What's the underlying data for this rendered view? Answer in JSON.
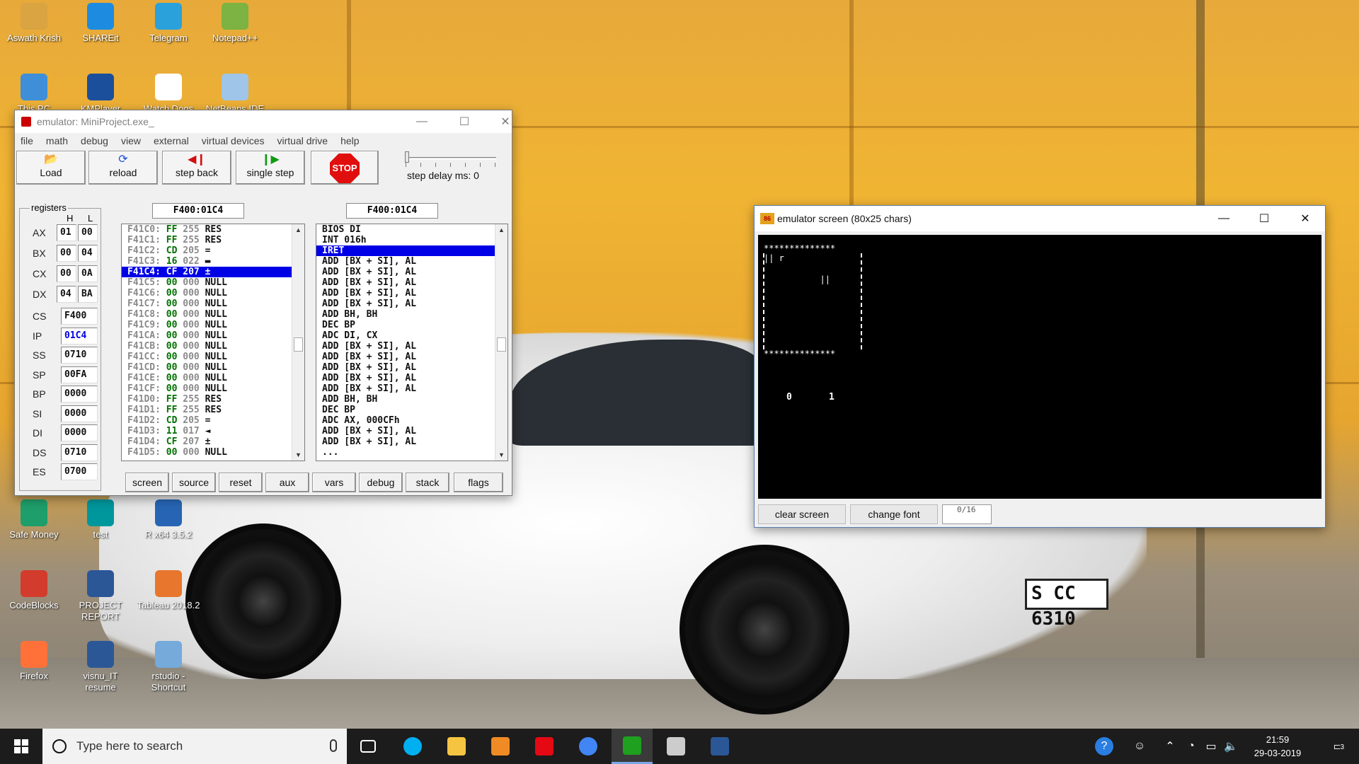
{
  "desktop": {
    "icons": [
      {
        "label": "Aswath Krish",
        "icon": "user-folder-icon",
        "color": "#d9a441"
      },
      {
        "label": "SHAREit",
        "icon": "shareit-icon",
        "color": "#1d8ce0"
      },
      {
        "label": "Telegram",
        "icon": "telegram-icon",
        "color": "#2aa1da"
      },
      {
        "label": "Notepad++",
        "icon": "notepadpp-icon",
        "color": "#7cb342"
      },
      {
        "label": "This PC",
        "icon": "computer-icon",
        "color": "#3f8fd8"
      },
      {
        "label": "KMPlayer",
        "icon": "kmplayer-icon",
        "color": "#1b4f9c"
      },
      {
        "label": "Watch Dogs",
        "icon": "watchdogs-icon",
        "color": "#ffffff"
      },
      {
        "label": "NetBeans IDE",
        "icon": "netbeans-icon",
        "color": "#9fc5e8"
      },
      {
        "label": "Safe Money",
        "icon": "safemoney-icon",
        "color": "#1e9e6a"
      },
      {
        "label": "test",
        "icon": "arduino-file-icon",
        "color": "#00979c"
      },
      {
        "label": "R x64 3.5.2",
        "icon": "r-icon",
        "color": "#2765b4"
      },
      {
        "label": "CodeBlocks",
        "icon": "codeblocks-icon",
        "color": "#d33c2c"
      },
      {
        "label": "PROJECT REPORT",
        "icon": "word-doc-icon",
        "color": "#2b5797"
      },
      {
        "label": "Tableau 2018.2",
        "icon": "tableau-icon",
        "color": "#e8762d"
      },
      {
        "label": "Firefox",
        "icon": "firefox-icon",
        "color": "#ff7139"
      },
      {
        "label": "visnu_IT resume",
        "icon": "word-doc-icon",
        "color": "#2b5797"
      },
      {
        "label": "rstudio - Shortcut",
        "icon": "rstudio-icon",
        "color": "#75aadb"
      }
    ],
    "plate": "S CC 6310"
  },
  "emulator": {
    "title": "emulator: MiniProject.exe_",
    "menu": [
      "file",
      "math",
      "debug",
      "view",
      "external",
      "virtual devices",
      "virtual drive",
      "help"
    ],
    "toolbar": {
      "load": "Load",
      "reload": "reload",
      "step_back": "step back",
      "single_step": "single step",
      "stop": "STOP",
      "step_delay": "step delay ms: 0"
    },
    "registers_title": "registers",
    "hl": {
      "h": "H",
      "l": "L"
    },
    "gp_registers": [
      {
        "name": "AX",
        "h": "01",
        "l": "00"
      },
      {
        "name": "BX",
        "h": "00",
        "l": "04"
      },
      {
        "name": "CX",
        "h": "00",
        "l": "0A"
      },
      {
        "name": "DX",
        "h": "04",
        "l": "BA"
      }
    ],
    "seg_registers": [
      {
        "name": "CS",
        "value": "F400"
      },
      {
        "name": "IP",
        "value": "01C4"
      },
      {
        "name": "SS",
        "value": "0710"
      },
      {
        "name": "SP",
        "value": "00FA"
      },
      {
        "name": "BP",
        "value": "0000"
      },
      {
        "name": "SI",
        "value": "0000"
      },
      {
        "name": "DI",
        "value": "0000"
      },
      {
        "name": "DS",
        "value": "0710"
      },
      {
        "name": "ES",
        "value": "0700"
      }
    ],
    "memory_address": "F400:01C4",
    "disasm_address": "F400:01C4",
    "memory_rows": [
      {
        "addr": "F41C0:",
        "hex": "FF",
        "dec": "255",
        "chr": "RES"
      },
      {
        "addr": "F41C1:",
        "hex": "FF",
        "dec": "255",
        "chr": "RES"
      },
      {
        "addr": "F41C2:",
        "hex": "CD",
        "dec": "205",
        "chr": "="
      },
      {
        "addr": "F41C3:",
        "hex": "16",
        "dec": "022",
        "chr": "▬"
      },
      {
        "addr": "F41C4:",
        "hex": "CF",
        "dec": "207",
        "chr": "±"
      },
      {
        "addr": "F41C5:",
        "hex": "00",
        "dec": "000",
        "chr": "NULL"
      },
      {
        "addr": "F41C6:",
        "hex": "00",
        "dec": "000",
        "chr": "NULL"
      },
      {
        "addr": "F41C7:",
        "hex": "00",
        "dec": "000",
        "chr": "NULL"
      },
      {
        "addr": "F41C8:",
        "hex": "00",
        "dec": "000",
        "chr": "NULL"
      },
      {
        "addr": "F41C9:",
        "hex": "00",
        "dec": "000",
        "chr": "NULL"
      },
      {
        "addr": "F41CA:",
        "hex": "00",
        "dec": "000",
        "chr": "NULL"
      },
      {
        "addr": "F41CB:",
        "hex": "00",
        "dec": "000",
        "chr": "NULL"
      },
      {
        "addr": "F41CC:",
        "hex": "00",
        "dec": "000",
        "chr": "NULL"
      },
      {
        "addr": "F41CD:",
        "hex": "00",
        "dec": "000",
        "chr": "NULL"
      },
      {
        "addr": "F41CE:",
        "hex": "00",
        "dec": "000",
        "chr": "NULL"
      },
      {
        "addr": "F41CF:",
        "hex": "00",
        "dec": "000",
        "chr": "NULL"
      },
      {
        "addr": "F41D0:",
        "hex": "FF",
        "dec": "255",
        "chr": "RES"
      },
      {
        "addr": "F41D1:",
        "hex": "FF",
        "dec": "255",
        "chr": "RES"
      },
      {
        "addr": "F41D2:",
        "hex": "CD",
        "dec": "205",
        "chr": "="
      },
      {
        "addr": "F41D3:",
        "hex": "11",
        "dec": "017",
        "chr": "◄"
      },
      {
        "addr": "F41D4:",
        "hex": "CF",
        "dec": "207",
        "chr": "±"
      },
      {
        "addr": "F41D5:",
        "hex": "00",
        "dec": "000",
        "chr": "NULL"
      }
    ],
    "memory_selected": 4,
    "disasm_rows": [
      "BIOS DI",
      "INT 016h",
      "IRET",
      "ADD [BX + SI], AL",
      "ADD [BX + SI], AL",
      "ADD [BX + SI], AL",
      "ADD [BX + SI], AL",
      "ADD [BX + SI], AL",
      "ADD BH, BH",
      "DEC BP",
      "ADC DI, CX",
      "ADD [BX + SI], AL",
      "ADD [BX + SI], AL",
      "ADD [BX + SI], AL",
      "ADD [BX + SI], AL",
      "ADD [BX + SI], AL",
      "ADD BH, BH",
      "DEC BP",
      "ADC AX, 000CFh",
      "ADD [BX + SI], AL",
      "ADD [BX + SI], AL",
      "..."
    ],
    "disasm_selected": 2,
    "bottom_buttons": [
      "screen",
      "source",
      "reset",
      "aux",
      "vars",
      "debug",
      "stack",
      "flags"
    ]
  },
  "screen": {
    "title": "emulator screen (80x25 chars)",
    "lines": [
      "**************",
      "|| r",
      "           ||",
      "**************"
    ],
    "score_left": "0",
    "score_right": "1",
    "clear_button": "clear screen",
    "font_button": "change font",
    "counter": "0/16"
  },
  "taskbar": {
    "search_placeholder": "Type here to search",
    "apps": [
      {
        "name": "task-view-icon"
      },
      {
        "name": "skype-icon",
        "color": "#00aff0"
      },
      {
        "name": "file-explorer-icon",
        "color": "#f5c542"
      },
      {
        "name": "media-player-icon",
        "color": "#f08a24"
      },
      {
        "name": "netflix-icon",
        "color": "#e50914"
      },
      {
        "name": "chrome-icon",
        "color": "#4285f4"
      },
      {
        "name": "emu8086-icon",
        "color": "#1fa01f"
      },
      {
        "name": "photos-icon",
        "color": "#cccccc"
      },
      {
        "name": "word-icon",
        "color": "#2b5797"
      }
    ],
    "time": "21:59",
    "date": "29-03-2019",
    "notifications": "3"
  }
}
